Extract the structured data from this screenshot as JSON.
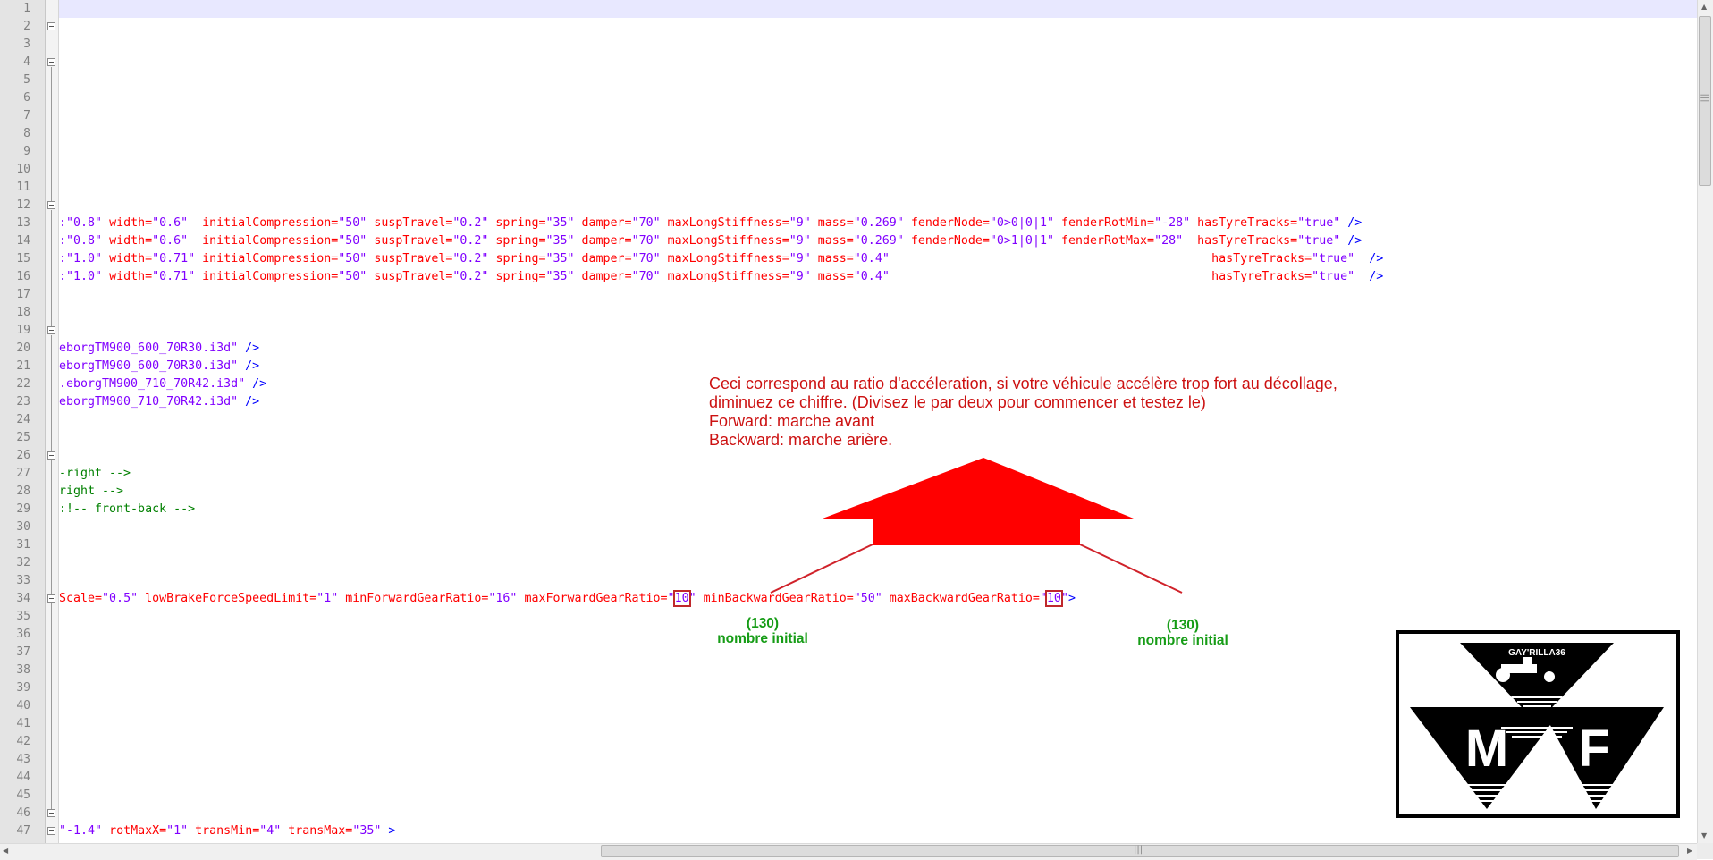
{
  "editor": {
    "line_numbers": [
      "1",
      "2",
      "3",
      "4",
      "5",
      "6",
      "7",
      "8",
      "9",
      "10",
      "11",
      "12",
      "13",
      "14",
      "15",
      "16",
      "17",
      "18",
      "19",
      "20",
      "21",
      "22",
      "23",
      "24",
      "25",
      "26",
      "27",
      "28",
      "29",
      "30",
      "31",
      "32",
      "33",
      "34",
      "35",
      "36",
      "37",
      "38",
      "39",
      "40",
      "41",
      "42",
      "43",
      "44",
      "45",
      "46",
      "47"
    ],
    "lines": {
      "l13": {
        "p1": ":\"0.8\"",
        "w_a": "width=",
        "w_v": "\"0.6\"",
        "ic_a": "initialCompression=",
        "ic_v": "\"50\"",
        "st_a": "suspTravel=",
        "st_v": "\"0.2\"",
        "sp_a": "spring=",
        "sp_v": "\"35\"",
        "d_a": "damper=",
        "d_v": "\"70\"",
        "m_a": "maxLongStiffness=",
        "m_v": "\"9\"",
        "ms_a": "mass=",
        "ms_v": "\"0.269\"",
        "fn_a": "fenderNode=",
        "fn_v": "\"0>0|0|1\"",
        "fr_a": "fenderRotMin=",
        "fr_v": "\"-28\"",
        "ht_a": "hasTyreTracks=",
        "ht_v": "\"true\"",
        "end": "/>"
      },
      "l14": {
        "p1": ":\"0.8\"",
        "w_a": "width=",
        "w_v": "\"0.6\"",
        "ic_a": "initialCompression=",
        "ic_v": "\"50\"",
        "st_a": "suspTravel=",
        "st_v": "\"0.2\"",
        "sp_a": "spring=",
        "sp_v": "\"35\"",
        "d_a": "damper=",
        "d_v": "\"70\"",
        "m_a": "maxLongStiffness=",
        "m_v": "\"9\"",
        "ms_a": "mass=",
        "ms_v": "\"0.269\"",
        "fn_a": "fenderNode=",
        "fn_v": "\"0>1|0|1\"",
        "fr_a": "fenderRotMax=",
        "fr_v": "\"28\"",
        "ht_a": "hasTyreTracks=",
        "ht_v": "\"true\"",
        "end": "/>"
      },
      "l15": {
        "p1": ":\"1.0\"",
        "w_a": "width=",
        "w_v": "\"0.71\"",
        "ic_a": "initialCompression=",
        "ic_v": "\"50\"",
        "st_a": "suspTravel=",
        "st_v": "\"0.2\"",
        "sp_a": "spring=",
        "sp_v": "\"35\"",
        "d_a": "damper=",
        "d_v": "\"70\"",
        "m_a": "maxLongStiffness=",
        "m_v": "\"9\"",
        "ms_a": "mass=",
        "ms_v": "\"0.4\"",
        "ht_a": "hasTyreTracks=",
        "ht_v": "\"true\"",
        "end": "/>"
      },
      "l16": {
        "p1": ":\"1.0\"",
        "w_a": "width=",
        "w_v": "\"0.71\"",
        "ic_a": "initialCompression=",
        "ic_v": "\"50\"",
        "st_a": "suspTravel=",
        "st_v": "\"0.2\"",
        "sp_a": "spring=",
        "sp_v": "\"35\"",
        "d_a": "damper=",
        "d_v": "\"70\"",
        "m_a": "maxLongStiffness=",
        "m_v": "\"9\"",
        "ms_a": "mass=",
        "ms_v": "\"0.4\"",
        "ht_a": "hasTyreTracks=",
        "ht_v": "\"true\"",
        "end": "/>"
      },
      "l20": {
        "v": "eborgTM900_600_70R30.i3d\"",
        "end": "/>"
      },
      "l21": {
        "v": "eborgTM900_600_70R30.i3d\"",
        "end": "/>"
      },
      "l22": {
        "v": ".eborgTM900_710_70R42.i3d\"",
        "end": "/>"
      },
      "l23": {
        "v": "eborgTM900_710_70R42.i3d\"",
        "end": "/>"
      },
      "l27": "-right -->",
      "l28": "right -->",
      "l29": ":!-- front-back -->",
      "l34": {
        "a1": "Scale=",
        "v1": "\"0.5\"",
        "a2": "lowBrakeForceSpeedLimit=",
        "v2": "\"1\"",
        "a3": "minForwardGearRatio=",
        "v3": "\"16\"",
        "a4": "maxForwardGearRatio=",
        "q1": "\"",
        "v4": "10",
        "q2": "\"",
        "a5": "minBackwardGearRatio=",
        "v5": "\"50\"",
        "a6": "maxBackwardGearRatio=",
        "q3": "\"",
        "v6": "10",
        "q4": "\"",
        "end": ">"
      },
      "l47": {
        "v1": "\"-1.4\"",
        "a2": "rotMaxX=",
        "v2": "\"1\"",
        "a3": "transMin=",
        "v3": "\"4\"",
        "a4": "transMax=",
        "v4": "\"35\"",
        "end": ">"
      }
    }
  },
  "annotation": {
    "note_line1": "Ceci correspond au ratio d'accéleration, si votre véhicule accélère trop fort au décollage,",
    "note_line2": "diminuez ce chiffre. (Divisez le par deux pour commencer et testez le)",
    "note_line3": "Forward: marche avant",
    "note_line4": "Backward: marche arière.",
    "forward_value": "(130)",
    "forward_caption": "nombre initial",
    "backward_value": "(130)",
    "backward_caption": "nombre initial",
    "arrow_color": "#ff0000"
  },
  "logo": {
    "signature": "GAY'RILLA36",
    "letters": [
      "M",
      "F"
    ]
  },
  "scrollbars": {
    "grip": "|||"
  }
}
